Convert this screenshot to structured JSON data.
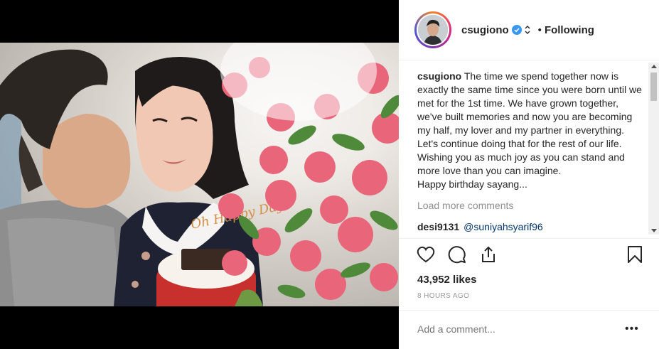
{
  "post": {
    "username": "csugiono",
    "separator": "•",
    "following_label": "Following",
    "caption_user": "csugiono",
    "caption_text": "The time we spend together now is exactly the same time since you were born until we met for the 1st time. We have grown together, we've built memories and now you are becoming my half, my lover and my partner in everything. Let's continue doing that for the rest of our life.\nWishing you as much joy as you can stand and more love than you can imagine.\nHappy birthday sayang...",
    "load_more": "Load more comments",
    "first_comment_user": "desi9131",
    "first_comment_mention": "@suniyahsyarif96",
    "likes": "43,952 likes",
    "time": "8 HOURS AGO",
    "comment_placeholder": "Add a comment...",
    "more_options": "•••",
    "cake_text": "Oh Happy Day"
  },
  "icons": [
    "heart-icon",
    "comment-icon",
    "share-icon",
    "bookmark-icon",
    "verified-icon"
  ],
  "colors": {
    "verified_blue": "#3897f0",
    "text": "#262626",
    "muted": "#999999",
    "mention": "#003569"
  }
}
